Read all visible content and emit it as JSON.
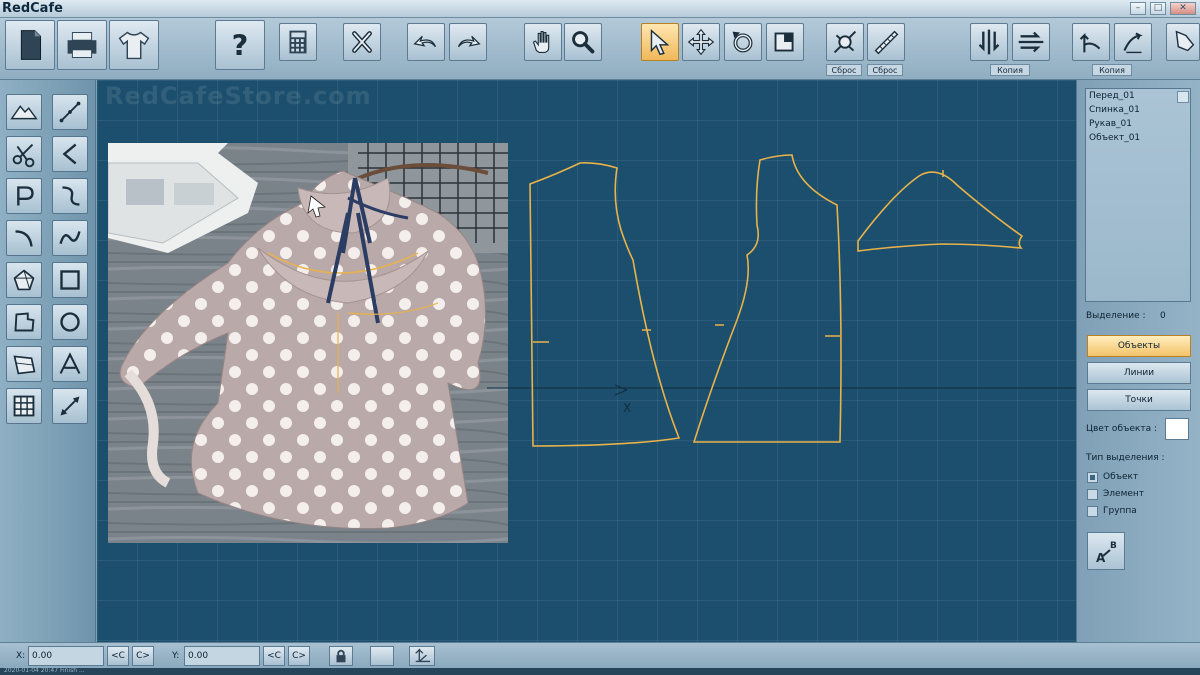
{
  "app": {
    "title": "RedCafe"
  },
  "window_controls": {
    "minimize": "–",
    "maximize": "□",
    "close": "✕"
  },
  "toolbar": {
    "buttons": [
      {
        "icon": "new-file-icon"
      },
      {
        "icon": "printer-icon"
      },
      {
        "icon": "shirt-icon"
      },
      {
        "icon": "help-icon",
        "text": "?"
      },
      {
        "icon": "calculator-icon"
      },
      {
        "icon": "delete-icon"
      },
      {
        "icon": "undo-icon"
      },
      {
        "icon": "redo-icon"
      },
      {
        "icon": "hand-pan-icon"
      },
      {
        "icon": "zoom-icon"
      },
      {
        "icon": "select-arrow-icon"
      },
      {
        "icon": "move-icon"
      },
      {
        "icon": "rotate-icon"
      },
      {
        "icon": "resize-icon"
      },
      {
        "icon": "target-icon"
      },
      {
        "icon": "ruler-icon"
      },
      {
        "icon": "mirror-vertical-icon"
      },
      {
        "icon": "mirror-horizontal-icon"
      },
      {
        "icon": "copy-left-icon"
      },
      {
        "icon": "copy-right-icon"
      },
      {
        "icon": "piece-icon"
      }
    ],
    "labels": {
      "reset_1": "Сброс",
      "reset_2": "Сброс",
      "copy_1": "Копия",
      "copy_2": "Копия"
    }
  },
  "canvas": {
    "watermark": "RedCafeStore.com",
    "axis_label": "X",
    "background": "#1b4f6d",
    "pattern_color": "#e9b24a"
  },
  "right_panel": {
    "objects": [
      "Перед_01",
      "Спинка_01",
      "Рукав_01",
      "Объект_01"
    ],
    "selection_label": "Выделение :",
    "selection_count": "0",
    "mode_buttons": {
      "objects": "Объекты",
      "lines": "Линии",
      "points": "Точки"
    },
    "object_color_label": "Цвет объекта :",
    "selection_type_label": "Тип выделения :",
    "selection_types": [
      {
        "label": "Объект",
        "checked": true
      },
      {
        "label": "Элемент",
        "checked": false
      },
      {
        "label": "Группа",
        "checked": false
      }
    ]
  },
  "status_bar": {
    "x_label": "X:",
    "x_value": "0.00",
    "y_label": "Y:",
    "y_value": "0.00",
    "prev": "<C",
    "next": "C>"
  },
  "footer_text": "2020-01-04 20:47 Finish ... "
}
